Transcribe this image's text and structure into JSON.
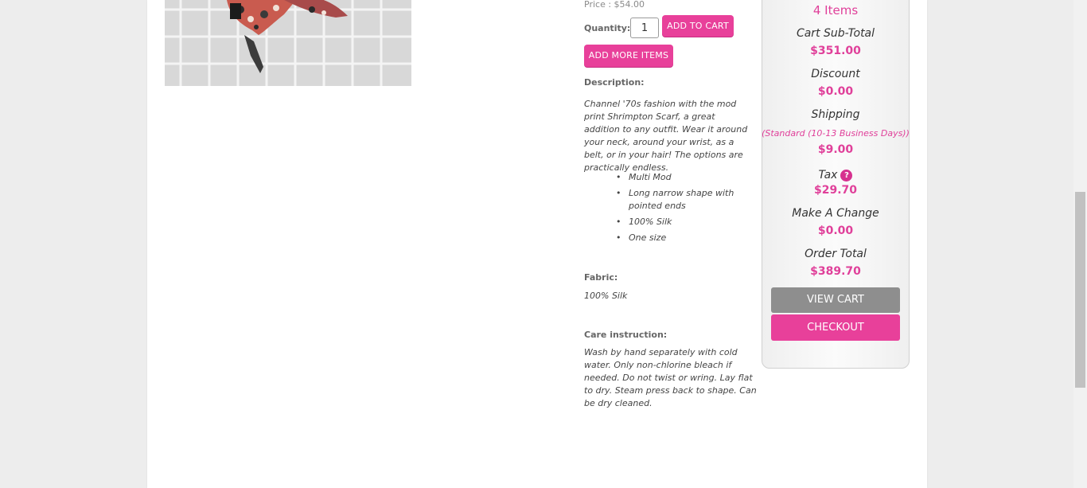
{
  "product": {
    "price": "Price : $54.00",
    "quantity_label": "Quantity:",
    "quantity_value": "1",
    "add_to_cart": "ADD TO CART",
    "add_more_items": "ADD MORE ITEMS",
    "description_label": "Description:",
    "description": "Channel '70s fashion with the mod print Shrimpton Scarf, a great addition to any outfit. Wear it around your neck, around your wrist, as a belt, or in your hair! The options are practically endless.",
    "bullets": [
      "Multi Mod",
      "Long narrow shape with pointed ends",
      "100% Silk",
      "One size"
    ],
    "fabric_label": "Fabric:",
    "fabric": "100% Silk",
    "care_label": "Care instruction:",
    "care": "Wash by hand separately with cold water. Only non-chlorine bleach if needed. Do not twist or wring. Lay flat to dry. Steam press back to shape. Can be dry cleaned."
  },
  "cart": {
    "item_count": "4 Items",
    "subtotal_label": "Cart Sub-Total",
    "subtotal": "$351.00",
    "discount_label": "Discount",
    "discount": "$0.00",
    "shipping_label": "Shipping",
    "shipping_method": "(Standard (10-13 Business Days))",
    "shipping": "$9.00",
    "tax_label": "Tax",
    "tax_help": "?",
    "tax": "$29.70",
    "change_label": "Make A Change",
    "change": "$0.00",
    "total_label": "Order Total",
    "total": "$389.70",
    "view_cart": "VIEW CART",
    "checkout": "CHECKOUT"
  },
  "colors": {
    "accent": "#e8409a",
    "view_cart_bg": "#8e8e8e"
  },
  "icons": {
    "tax_help": "help-icon"
  }
}
